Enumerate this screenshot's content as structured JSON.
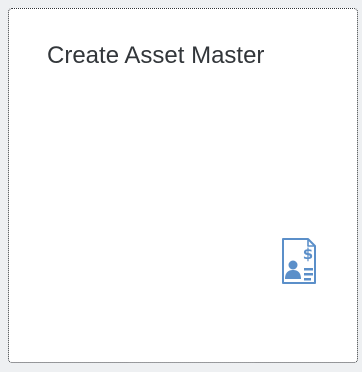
{
  "tile": {
    "title": "Create Asset Master",
    "icon": "asset-master-icon",
    "icon_color": "#5b8fc9"
  }
}
